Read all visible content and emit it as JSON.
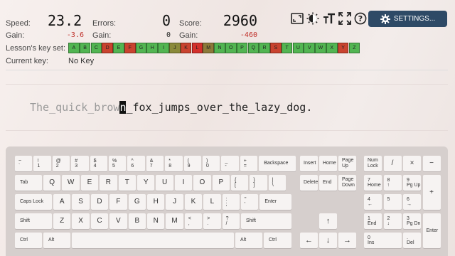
{
  "stats": {
    "speed": {
      "label": "Speed:",
      "value": "23.2",
      "gain_label": "Gain:",
      "gain": "-3.6"
    },
    "errors": {
      "label": "Errors:",
      "value": "0",
      "gain_label": "Gain:",
      "gain": "0"
    },
    "score": {
      "label": "Score:",
      "value": "2960",
      "gain_label": "Gain:",
      "gain": "-460"
    }
  },
  "toolbar": {
    "icons": [
      "fullscreen-window-icon",
      "theme-icon",
      "font-size-icon",
      "expand-icon",
      "help-icon"
    ],
    "settings_label": "SETTINGS..."
  },
  "keyset": {
    "label": "Lesson's key set:",
    "keys": [
      {
        "k": "A",
        "color": "#52b552"
      },
      {
        "k": "B",
        "color": "#52b552"
      },
      {
        "k": "C",
        "color": "#52b552"
      },
      {
        "k": "D",
        "color": "#c9432f"
      },
      {
        "k": "E",
        "color": "#52b552"
      },
      {
        "k": "F",
        "color": "#c9432f"
      },
      {
        "k": "G",
        "color": "#52b552"
      },
      {
        "k": "H",
        "color": "#52b552"
      },
      {
        "k": "I",
        "color": "#52b552"
      },
      {
        "k": "J",
        "color": "#8a8a3a"
      },
      {
        "k": "K",
        "color": "#c9432f"
      },
      {
        "k": "L",
        "color": "#d3302c"
      },
      {
        "k": "M",
        "color": "#8c7a3a"
      },
      {
        "k": "N",
        "color": "#52b552"
      },
      {
        "k": "O",
        "color": "#52b552"
      },
      {
        "k": "P",
        "color": "#52b552"
      },
      {
        "k": "Q",
        "color": "#52b552"
      },
      {
        "k": "R",
        "color": "#52b552"
      },
      {
        "k": "S",
        "color": "#c9432f"
      },
      {
        "k": "T",
        "color": "#52b552"
      },
      {
        "k": "U",
        "color": "#52b552"
      },
      {
        "k": "V",
        "color": "#52b552"
      },
      {
        "k": "W",
        "color": "#52b552"
      },
      {
        "k": "X",
        "color": "#52b552"
      },
      {
        "k": "Y",
        "color": "#c9432f"
      },
      {
        "k": "Z",
        "color": "#52b552"
      }
    ]
  },
  "current_key": {
    "label": "Current key:",
    "value": "No Key"
  },
  "lesson_text": {
    "typed": "The_quick_brow",
    "cursor": "n",
    "upcoming": "_fox_jumps_over_the_lazy_dog."
  },
  "keyboard": {
    "row1": [
      {
        "t": "~",
        "b": "`"
      },
      {
        "t": "!",
        "b": "1"
      },
      {
        "t": "@",
        "b": "2"
      },
      {
        "t": "#",
        "b": "3"
      },
      {
        "t": "$",
        "b": "4"
      },
      {
        "t": "%",
        "b": "5"
      },
      {
        "t": "^",
        "b": "6"
      },
      {
        "t": "&",
        "b": "7"
      },
      {
        "t": "*",
        "b": "8"
      },
      {
        "t": "(",
        "b": "9"
      },
      {
        "t": ")",
        "b": "0"
      },
      {
        "t": "_",
        "b": "-"
      },
      {
        "t": "+",
        "b": "="
      }
    ],
    "backspace": "Backspace",
    "tab": "Tab",
    "row2": [
      "Q",
      "W",
      "E",
      "R",
      "T",
      "Y",
      "U",
      "I",
      "O",
      "P"
    ],
    "row2_sym": [
      {
        "t": "{",
        "b": "["
      },
      {
        "t": "}",
        "b": "]"
      },
      {
        "t": "|",
        "b": "\\"
      }
    ],
    "caps": "Caps Lock",
    "row3": [
      "A",
      "S",
      "D",
      "F",
      "G",
      "H",
      "J",
      "K",
      "L"
    ],
    "row3_sym": [
      {
        "t": ":",
        "b": ";"
      },
      {
        "t": "\"",
        "b": "'"
      }
    ],
    "enter": "Enter",
    "shift_left": "Shift",
    "row4": [
      "Z",
      "X",
      "C",
      "V",
      "B",
      "N",
      "M"
    ],
    "row4_sym": [
      {
        "t": "<",
        "b": ","
      },
      {
        "t": ">",
        "b": "."
      },
      {
        "t": "?",
        "b": "/"
      }
    ],
    "shift_right": "Shift",
    "ctrl_left": "Ctrl",
    "alt_left": "Alt",
    "alt_right": "Alt",
    "ctrl_right": "Ctrl",
    "nav": {
      "insert": "Insert",
      "home": "Home",
      "pageup": "Page\nUp",
      "delete": "Delete",
      "end": "End",
      "pagedown": "Page\nDown",
      "up": "↑",
      "left": "←",
      "down": "↓",
      "right": "→"
    },
    "numpad": {
      "numlock": "Num\nLock",
      "divide": "/",
      "multiply": "×",
      "minus": "−",
      "n7": {
        "t": "7",
        "b": "Home"
      },
      "n8": {
        "t": "8",
        "b": "↑"
      },
      "n9": {
        "t": "9",
        "b": "Pg Up"
      },
      "plus": "+",
      "n4": {
        "t": "4",
        "b": "←"
      },
      "n5": {
        "t": "5",
        "b": ""
      },
      "n6": {
        "t": "6",
        "b": "→"
      },
      "n1": {
        "t": "1",
        "b": "End"
      },
      "n2": {
        "t": "2",
        "b": "↓"
      },
      "n3": {
        "t": "3",
        "b": "Pg Dn"
      },
      "enter": "Enter",
      "n0": {
        "t": "0",
        "b": "Ins"
      },
      "dot": {
        "t": ".",
        "b": "Del"
      }
    }
  }
}
